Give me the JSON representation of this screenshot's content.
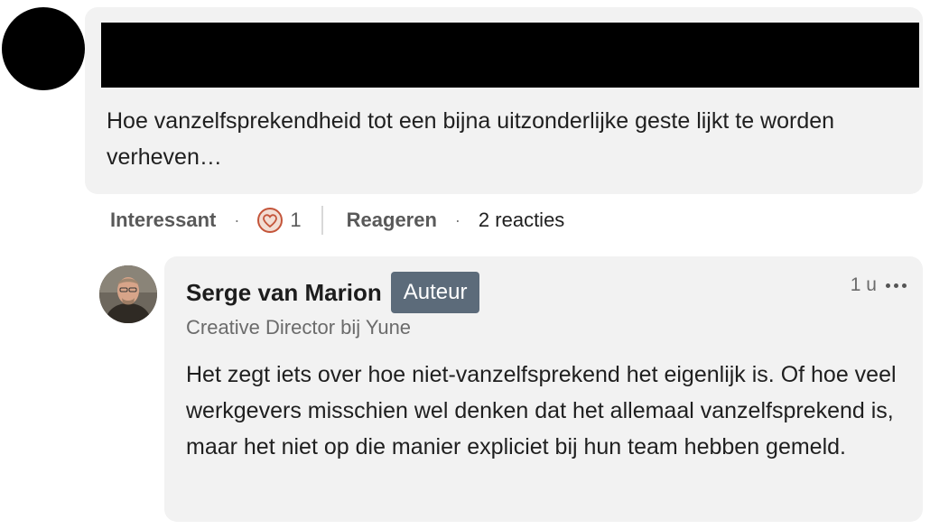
{
  "top_comment": {
    "text": "Hoe vanzelfsprekendheid tot een bijna uitzonderlijke geste lijkt te worden verheven…"
  },
  "actions": {
    "like_label": "Interessant",
    "separator": "·",
    "reaction_count": "1",
    "reply_label": "Reageren",
    "replies_count_label": "2 reacties"
  },
  "reply": {
    "author_name": "Serge van Marion",
    "author_badge": "Auteur",
    "author_headline": "Creative Director bij Yune",
    "timestamp": "1 u",
    "text": "Het zegt iets over hoe niet-vanzelfsprekend het eigenlijk is. Of hoe veel werkgevers misschien wel denken dat het allemaal vanzelfsprekend is, maar het niet op die manier expliciet bij hun team hebben gemeld."
  },
  "icons": {
    "reaction": "heart-icon",
    "more": "more-options-icon"
  },
  "colors": {
    "bubble_bg": "#f2f2f2",
    "badge_bg": "#5c6b7a",
    "heart": "#c4553a"
  }
}
